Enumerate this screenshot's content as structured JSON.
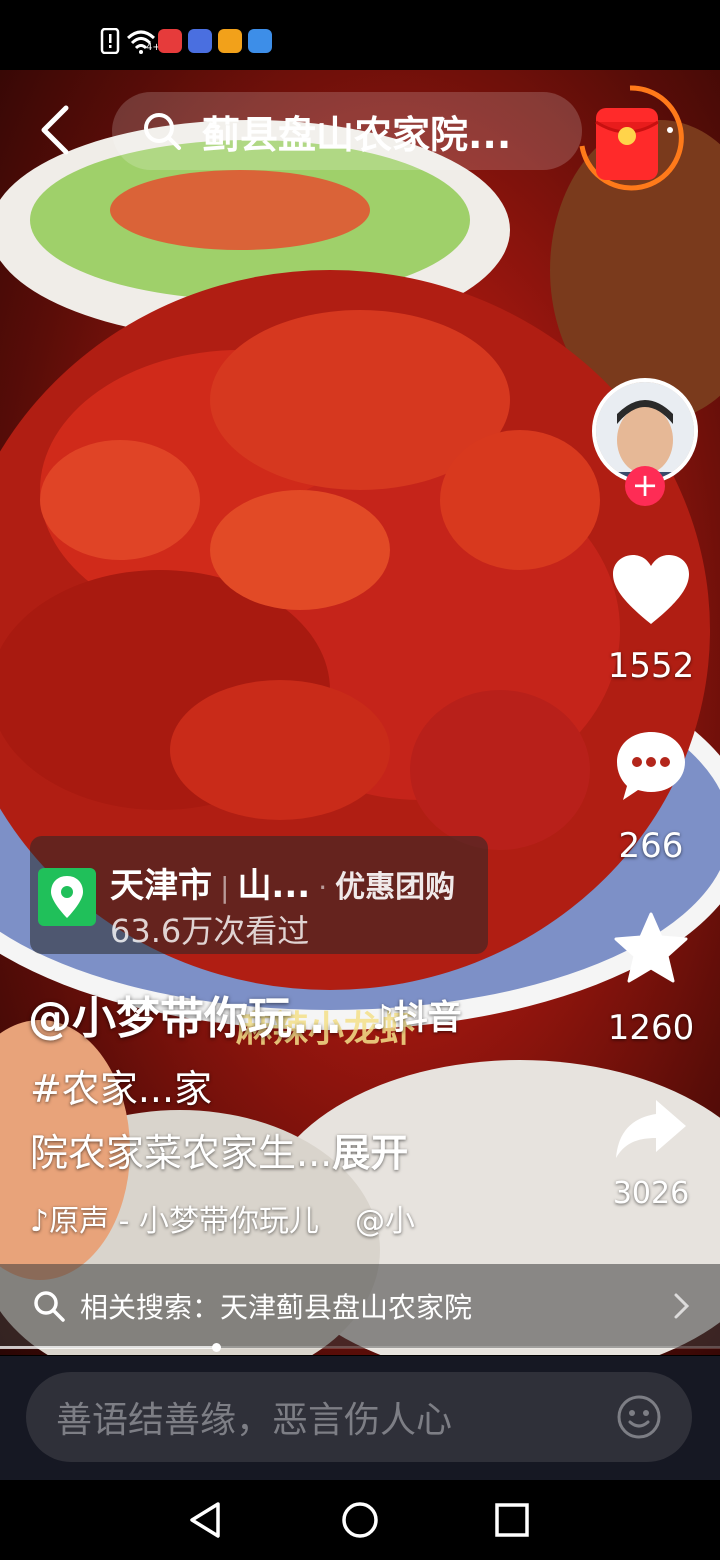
{
  "status_bar": {
    "icons": [
      "sim-alert-icon",
      "wifi-icon",
      "red-book-app-icon",
      "music-app-icon",
      "video-app-icon",
      "browser-app-icon"
    ],
    "wifi_label": "4+"
  },
  "header": {
    "search_text": "蓟县盘山农家院...",
    "icons": [
      "back-icon",
      "search-icon",
      "red-packet-icon"
    ]
  },
  "actions": {
    "likes": "1552",
    "comments": "266",
    "favorites": "1260",
    "shares": "3026",
    "follow_symbol": "+"
  },
  "poi": {
    "city": "天津市",
    "place": "山...",
    "tag": "优惠团购",
    "views": "63.6万次看过"
  },
  "caption": {
    "author": "@小梦带你玩...",
    "watermark": "♪抖音",
    "overlay_subtitle": "麻辣小龙虾",
    "hashtags": "#农家...家",
    "description": "院农家菜农家生...",
    "expand_label": "展开",
    "music": "♪原声 - 小梦带你玩儿",
    "music_at": "@小"
  },
  "related_search": {
    "text": "相关搜索：天津蓟县盘山农家院"
  },
  "progress": {
    "fraction": 0.3
  },
  "comment_bar": {
    "placeholder": "善语结善缘，恶言伤人心"
  },
  "colors": {
    "accent": "#fe2c55",
    "poi_green": "#20c05a",
    "comment_bg": "#161823",
    "red_packet": "#ff2a2a",
    "timer_ring": "#ff7a1a"
  }
}
